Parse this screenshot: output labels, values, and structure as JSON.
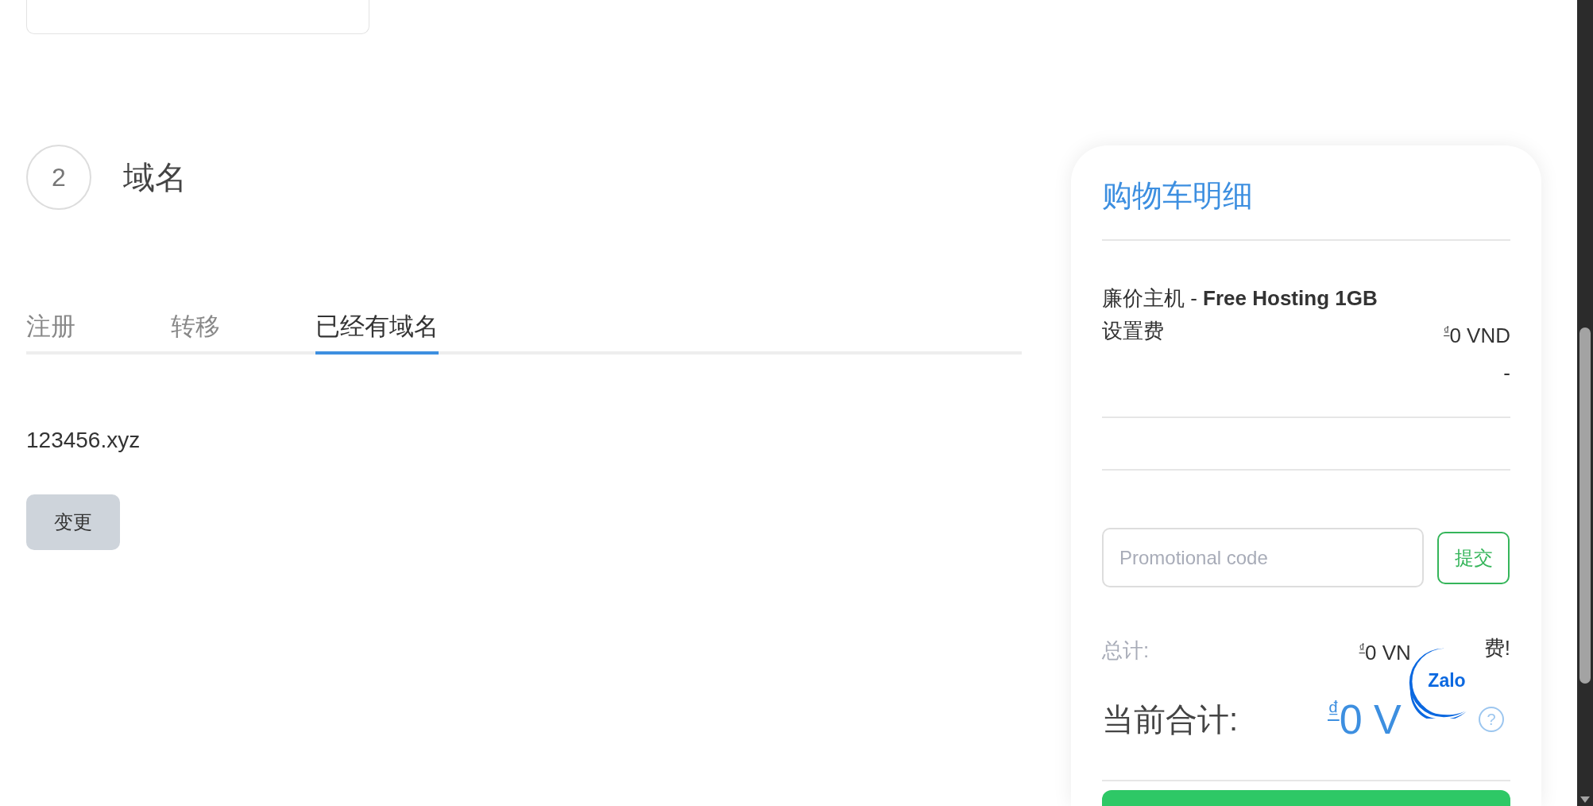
{
  "step": {
    "number": "2",
    "title": "域名"
  },
  "domain_tabs": [
    {
      "label": "注册",
      "selected": false
    },
    {
      "label": "转移",
      "selected": false
    },
    {
      "label": "已经有域名",
      "selected": true
    }
  ],
  "domain": {
    "value": "123456.xyz",
    "change_button": "变更"
  },
  "cart": {
    "title": "购物车明细",
    "item": "廉价主机 - **Free Hosting 1GB**",
    "setup_fee": {
      "label": "设置费",
      "value": "$^{₫}$0 VND",
      "note": "-"
    },
    "promo": {
      "placeholder": "Promotional code",
      "submit": "提交"
    },
    "total": {
      "label": "总计:",
      "value": "$^{₫}$0 VN",
      "note": "费!"
    },
    "current_total": {
      "label": "当前合计:",
      "value": "$^{₫}$0 V",
      "help": "?"
    }
  },
  "chat_widget": {
    "label": "Zalo"
  }
}
